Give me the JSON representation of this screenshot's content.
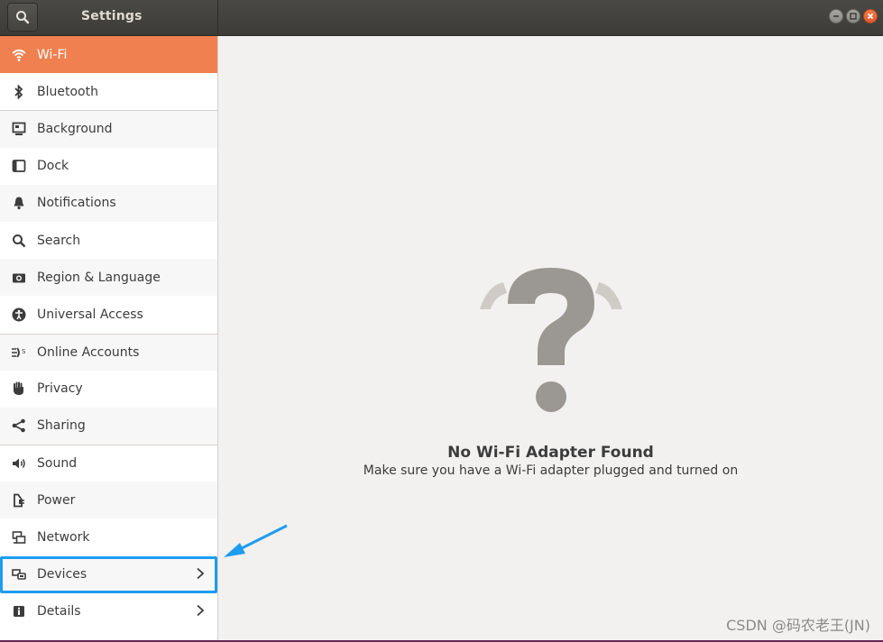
{
  "window": {
    "title": "Settings",
    "controls": [
      "minimize",
      "maximize",
      "close"
    ]
  },
  "header": {
    "search_icon": "search-icon"
  },
  "sidebar": {
    "items": [
      {
        "label": "Wi-Fi",
        "icon": "wifi-icon",
        "active": true
      },
      {
        "label": "Bluetooth",
        "icon": "bluetooth-icon"
      },
      {
        "label": "Background",
        "icon": "background-icon"
      },
      {
        "label": "Dock",
        "icon": "dock-icon"
      },
      {
        "label": "Notifications",
        "icon": "bell-icon"
      },
      {
        "label": "Search",
        "icon": "search-icon"
      },
      {
        "label": "Region & Language",
        "icon": "camera-icon"
      },
      {
        "label": "Universal Access",
        "icon": "accessibility-icon"
      },
      {
        "label": "Online Accounts",
        "icon": "online-accounts-icon"
      },
      {
        "label": "Privacy",
        "icon": "hand-icon"
      },
      {
        "label": "Sharing",
        "icon": "share-icon"
      },
      {
        "label": "Sound",
        "icon": "speaker-icon"
      },
      {
        "label": "Power",
        "icon": "power-icon"
      },
      {
        "label": "Network",
        "icon": "network-icon"
      },
      {
        "label": "Devices",
        "icon": "devices-icon",
        "chevron": true,
        "highlighted": true
      },
      {
        "label": "Details",
        "icon": "info-icon",
        "chevron": true
      }
    ]
  },
  "main": {
    "empty_icon": "question-mark-icon",
    "title": "No Wi-Fi Adapter Found",
    "subtitle": "Make sure you have a Wi-Fi adapter plugged and turned on"
  },
  "watermark": "CSDN @码农老王(JN)",
  "colors": {
    "accent": "#f08050",
    "highlight_box": "#1e9cf0",
    "header": "#3c3b37"
  }
}
